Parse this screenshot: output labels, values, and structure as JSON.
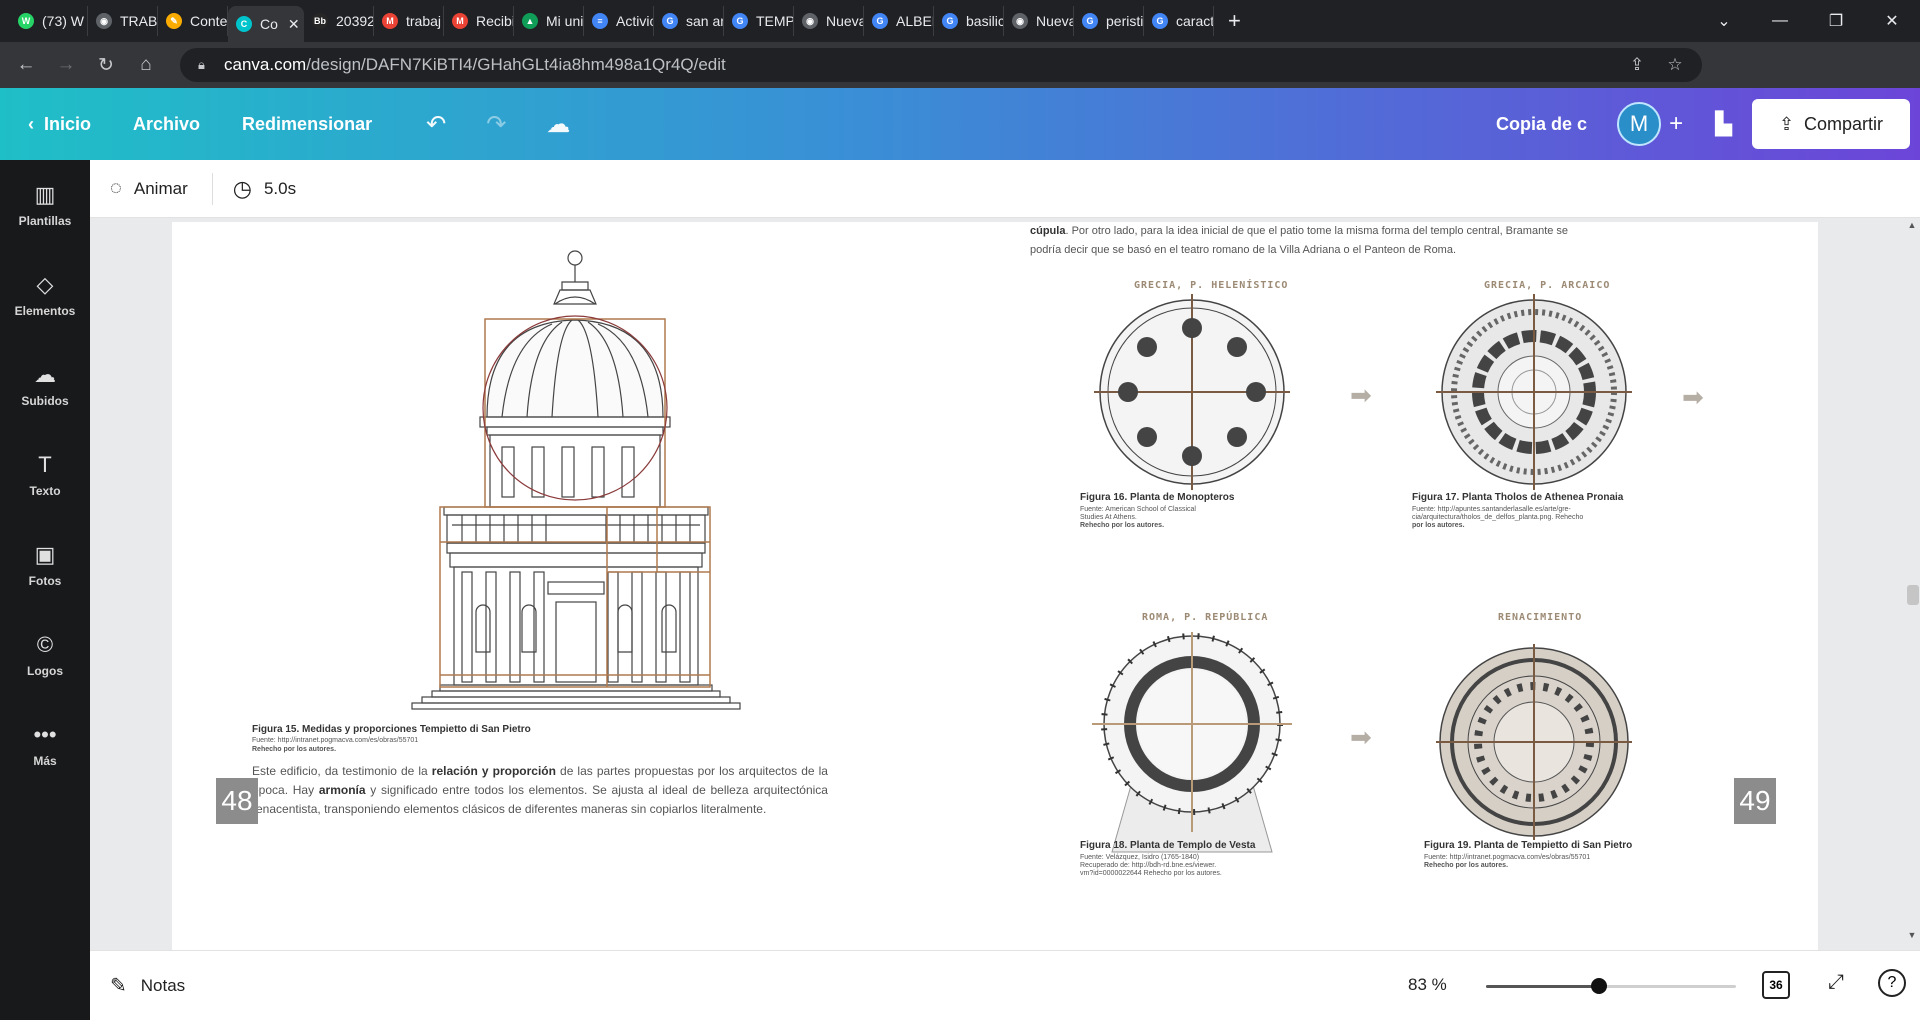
{
  "browser": {
    "tabs": [
      {
        "label": "(73) W",
        "color": "#25d366",
        "glyph": "W"
      },
      {
        "label": "TRABA",
        "color": "#5f6368",
        "glyph": "◉"
      },
      {
        "label": "Conte",
        "color": "#f9ab00",
        "glyph": "✎"
      },
      {
        "label": "Co",
        "color": "#00c4cc",
        "glyph": "C",
        "active": true
      },
      {
        "label": "20392",
        "color": "#262626",
        "glyph": "Bb"
      },
      {
        "label": "trabaj",
        "color": "#ea4335",
        "glyph": "M"
      },
      {
        "label": "Recibi",
        "color": "#ea4335",
        "glyph": "M"
      },
      {
        "label": "Mi uni",
        "color": "#0f9d58",
        "glyph": "▲"
      },
      {
        "label": "Activic",
        "color": "#4285f4",
        "glyph": "≡"
      },
      {
        "label": "san an",
        "color": "#4285f4",
        "glyph": "G"
      },
      {
        "label": "TEMPL",
        "color": "#4285f4",
        "glyph": "G"
      },
      {
        "label": "Nueva",
        "color": "#5f6368",
        "glyph": "◉"
      },
      {
        "label": "ALBER",
        "color": "#4285f4",
        "glyph": "G"
      },
      {
        "label": "basilic",
        "color": "#4285f4",
        "glyph": "G"
      },
      {
        "label": "Nueva",
        "color": "#5f6368",
        "glyph": "◉"
      },
      {
        "label": "peristi",
        "color": "#4285f4",
        "glyph": "G"
      },
      {
        "label": "caract",
        "color": "#4285f4",
        "glyph": "G"
      }
    ],
    "close_glyph": "✕",
    "new_tab": "+",
    "url_host": "canva.com",
    "url_path": "/design/DAFN7KiBTI4/GHahGLt4ia8hm498a1Qr4Q/edit"
  },
  "header": {
    "back_label": "Inicio",
    "file_label": "Archivo",
    "resize_label": "Redimensionar",
    "design_title": "Copia de c",
    "avatar_letter": "M",
    "share_label": "Compartir"
  },
  "sidebar": [
    {
      "label": "Plantillas",
      "icon": "▥"
    },
    {
      "label": "Elementos",
      "icon": "◇"
    },
    {
      "label": "Subidos",
      "icon": "☁"
    },
    {
      "label": "Texto",
      "icon": "T"
    },
    {
      "label": "Fotos",
      "icon": "▣"
    },
    {
      "label": "Logos",
      "icon": "©"
    },
    {
      "label": "Más",
      "icon": "•••"
    }
  ],
  "toolbar": {
    "animate_label": "Animar",
    "duration": "5.0s"
  },
  "document": {
    "top_text_bold": "cúpula",
    "top_text_1": ". Por otro lado, para la idea inicial de que el patio tome la misma forma del templo central, Bramante se",
    "top_text_2": "podría decir que se basó en el teatro romano de la Villa Adriana o el Panteon de Roma.",
    "fig15": {
      "caption": "Figura 15. Medidas y proporciones Tempietto di San Pietro",
      "source": "Fuente: http://intranet.pogmacva.com/es/obras/55701",
      "note": "Rehecho por los autores."
    },
    "body_1": "Este edificio, da testimonio de la",
    "body_b1": "relación y proporción",
    "body_2": "de las partes propuestas por los arquitectos de la época.",
    "body_3": "Hay",
    "body_b2": "armonía",
    "body_4": "y significado entre todos los elementos. Se ajusta al ideal de belleza arquitectónica renacentista,",
    "body_5": "transponiendo elementos clásicos de diferentes maneras sin copiarlos literalmente.",
    "page_left": "48",
    "page_right": "49",
    "section_titles": [
      "GRECIA, P. HELENÍSTICO",
      "GRECIA, P. ARCAICO",
      "ROMA, P. REPÚBLICA",
      "RENACIMIENTO"
    ],
    "fig16": {
      "caption": "Figura 16. Planta de Monopteros",
      "source": "Fuente: American School of Classical",
      "source2": "Studies At Athens.",
      "note": "Rehecho por los autores."
    },
    "fig17": {
      "caption": "Figura 17. Planta Tholos de Athenea Pronaia",
      "source": "Fuente: http://apuntes.santanderlasalle.es/arte/gre-",
      "source2": "cia/arquitectura/tholos_de_delfos_planta.png. Rehecho",
      "note": "por los autores."
    },
    "fig18": {
      "caption": "Figura 18. Planta de Templo de Vesta",
      "source": "Fuente: Velázquez, Isidro (1765-1840)",
      "source2": "Recuperado de: http://bdh-rd.bne.es/viewer.",
      "note": "vm?id=0000022644   Rehecho por los autores."
    },
    "fig19": {
      "caption": "Figura 19. Planta de Tempietto di San Pietro",
      "source": "Fuente: http://intranet.pogmacva.com/es/obras/55701",
      "note": "Rehecho por los autores."
    }
  },
  "bottom": {
    "notes_label": "Notas",
    "zoom": "83 %",
    "zoom_level": 0.45,
    "page_count": "36",
    "help": "?"
  }
}
